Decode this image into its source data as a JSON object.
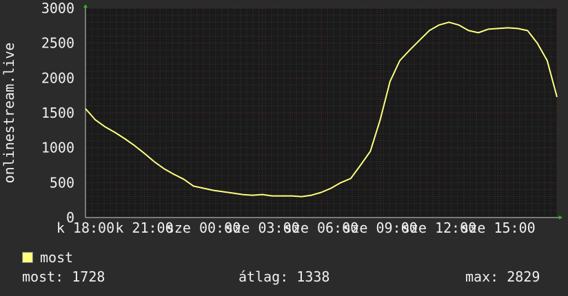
{
  "chart_data": {
    "type": "line",
    "ylabel": "onlinestream.live",
    "ylim": [
      0,
      3000
    ],
    "yticks": [
      0,
      500,
      1000,
      1500,
      2000,
      2500,
      3000
    ],
    "xticks": [
      "k 18:00",
      "k 21:00",
      "sze 00:00",
      "sze 03:00",
      "sze 06:00",
      "sze 09:00",
      "sze 12:00",
      "sze 15:00"
    ],
    "grid": true,
    "legend_position": "bottom-left",
    "series": [
      {
        "name": "most",
        "color": "#ffff80",
        "x_hours": [
          0,
          0.5,
          1,
          1.5,
          2,
          2.5,
          3,
          3.5,
          4,
          4.5,
          5,
          5.5,
          6,
          6.5,
          7,
          7.5,
          8,
          8.5,
          9,
          9.5,
          10,
          10.5,
          11,
          11.5,
          12,
          12.5,
          13,
          13.5,
          14,
          14.5,
          15,
          15.5,
          16,
          16.5,
          17,
          17.5,
          18,
          18.5,
          19,
          19.5,
          20,
          20.5,
          21,
          21.5,
          22,
          22.5,
          23,
          23.5,
          24
        ],
        "values": [
          1560,
          1400,
          1300,
          1220,
          1130,
          1030,
          920,
          800,
          700,
          620,
          550,
          450,
          420,
          390,
          370,
          350,
          330,
          320,
          330,
          310,
          310,
          310,
          300,
          320,
          360,
          420,
          500,
          560,
          750,
          950,
          1400,
          1950,
          2250,
          2400,
          2540,
          2680,
          2760,
          2800,
          2760,
          2680,
          2650,
          2700,
          2710,
          2720,
          2710,
          2680,
          2500,
          2250,
          1728
        ]
      }
    ]
  },
  "legend": {
    "label": "most",
    "color": "#ffff80"
  },
  "stats": {
    "now": "most: 1728",
    "avg": "átlag: 1338",
    "max": "max: 2829"
  }
}
